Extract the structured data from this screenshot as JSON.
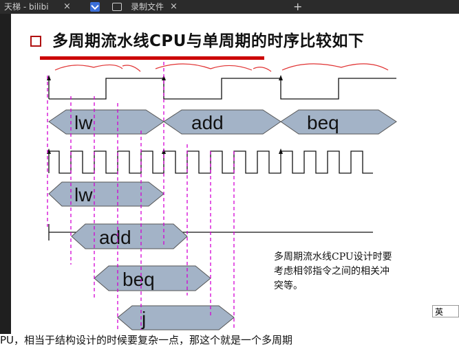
{
  "browser": {
    "tabs": [
      {
        "label": "天梯 - bilibi",
        "close": "×"
      },
      {
        "label": "录制文件",
        "close": "×"
      }
    ],
    "new_tab": "+"
  },
  "slide": {
    "title": "多周期流水线CPU与单周期的时序比较如下",
    "single_cycle_instructions": [
      "lw",
      "add",
      "beq"
    ],
    "pipeline_instructions": [
      "lw",
      "add",
      "beq",
      "j"
    ],
    "note": "多周期流水线CPU设计时要考虑相邻指令之间的相关冲突等。"
  },
  "ime": {
    "label": "英"
  },
  "subtitle": {
    "text": "PU，相当于结构设计的时候要复杂一点，那这个就是一个多周期"
  },
  "colors": {
    "stage_fill": "#a3b3c7",
    "guide_line": "#d400d4",
    "accent_red": "#cc0000",
    "annotation_red": "#e03030"
  }
}
